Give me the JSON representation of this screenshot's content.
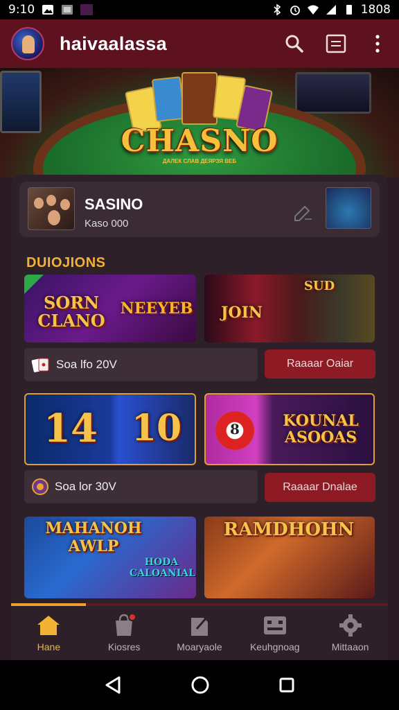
{
  "status_bar": {
    "time": "9:10",
    "battery": "1808"
  },
  "app_bar": {
    "title": "haivaalassa"
  },
  "hero": {
    "title": "CHASNO",
    "subtitle": "ДАЛЕК СЛАВ ДЕЯРЗЯ ВЕБ"
  },
  "profile": {
    "name": "SASINO",
    "subtitle": "Kaso 000"
  },
  "section": {
    "title": "DUIOJIONS"
  },
  "tiles": [
    {
      "label": "SORN CLANO",
      "label2": "NEEYEB"
    },
    {
      "label": "JOIN",
      "label2": "SUD"
    },
    {
      "label": "14",
      "label2": "10"
    },
    {
      "label": "8",
      "label2": "KOUNAL ASOOAS"
    },
    {
      "label": "MAHANOH AWLP",
      "label2": "HODA CALOANIAL"
    },
    {
      "label": "RAMDHOHN",
      "label2": ""
    }
  ],
  "rows": [
    {
      "text": "Soa lfo 20V",
      "button": "Raaaar Oaiar"
    },
    {
      "text": "Soa lor 30V",
      "button": "Raaaar Dnalae"
    }
  ],
  "nav": {
    "items": [
      {
        "label": "Hane",
        "icon": "home-icon"
      },
      {
        "label": "Kiosres",
        "icon": "bag-icon"
      },
      {
        "label": "Moaryaole",
        "icon": "note-icon"
      },
      {
        "label": "Keuhgnoag",
        "icon": "board-icon"
      },
      {
        "label": "Mittaaon",
        "icon": "gear-icon"
      }
    ],
    "active": 0
  },
  "colors": {
    "app_bar": "#5e1220",
    "accent": "#f2b234",
    "button": "#8e1a24",
    "panel": "#2d2029"
  }
}
